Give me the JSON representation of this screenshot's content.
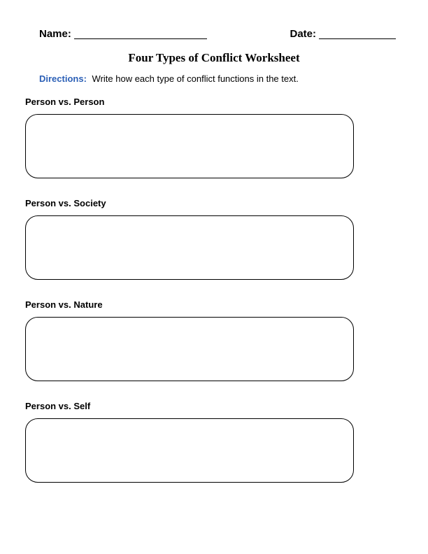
{
  "header": {
    "name_label": "Name:",
    "date_label": "Date:"
  },
  "title": "Four Types of Conflict Worksheet",
  "directions": {
    "label": "Directions:",
    "text": "Write how each type of conflict functions in the text."
  },
  "sections": [
    {
      "heading": "Person vs. Person"
    },
    {
      "heading": "Person vs. Society"
    },
    {
      "heading": "Person vs. Nature"
    },
    {
      "heading": "Person vs. Self"
    }
  ]
}
